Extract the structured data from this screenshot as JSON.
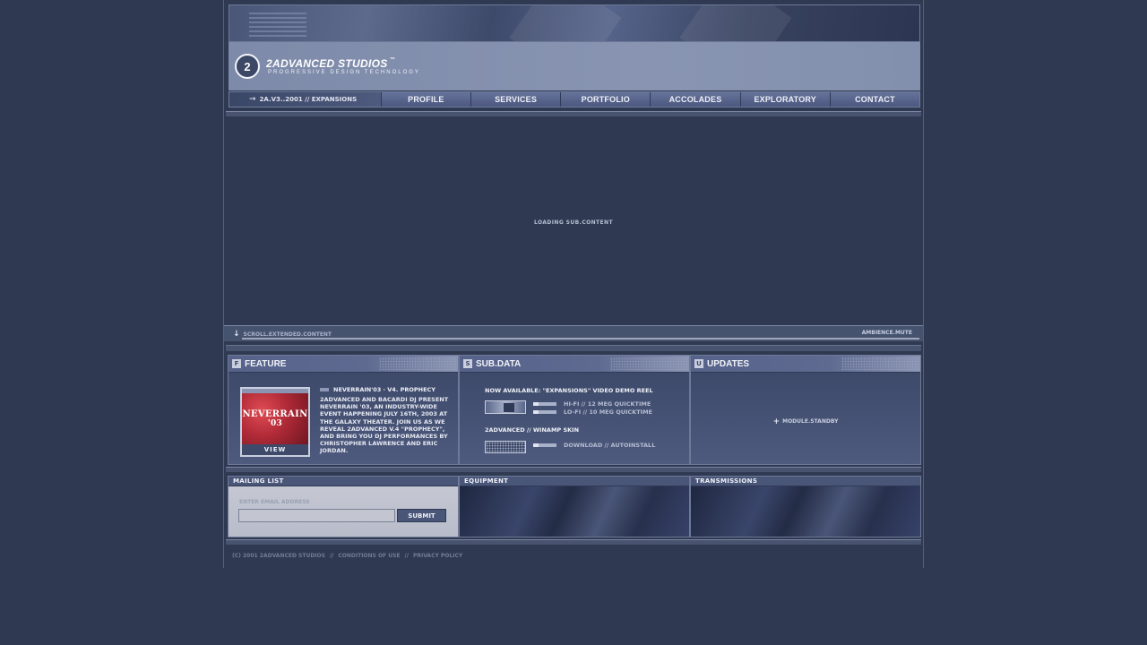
{
  "brand": {
    "name": "2ADVANCED STUDIOS",
    "trademark": "™",
    "tagline": "PROGRESSIVE DESIGN TECHNOLOGY",
    "mark": "2"
  },
  "nav": {
    "current": "2A.V3..2001 // EXPANSIONS",
    "items": [
      "PROFILE",
      "SERVICES",
      "PORTFOLIO",
      "ACCOLADES",
      "EXPLORATORY",
      "CONTACT"
    ]
  },
  "main": {
    "loading": "LOADING SUB.CONTENT"
  },
  "scroll_bar": {
    "scroll": "SCROLL.EXTENDED.CONTENT",
    "ambience": "AMBIENCE.MUTE"
  },
  "feature": {
    "title": "FEATURE",
    "headline": "NEVERRAIN'03 · V4. PROPHECY",
    "body": "2ADVANCED AND BACARDI DJ PRESENT NEVERRAIN '03, AN INDUSTRY-WIDE EVENT HAPPENING JULY 16TH, 2003 AT THE GALAXY THEATER. JOIN US AS WE REVEAL 2ADVANCED V.4 \"PROPHECY\", AND BRING YOU DJ PERFORMANCES BY CHRISTOPHER LAWRENCE AND ERIC JORDAN.",
    "thumb_line1": "NEVERRAIN",
    "thumb_line2": "'03",
    "view": "VIEW"
  },
  "subdata": {
    "title": "SUB.DATA",
    "now_available": "NOW AVAILABLE: \"EXPANSIONS\" VIDEO DEMO REEL",
    "hifi": "HI-FI // 12 MEG QUICKTIME",
    "lofi": "LO-FI // 10 MEG QUICKTIME",
    "winamp": "2ADVANCED // WINAMP SKIN",
    "download": "DOWNLOAD // AUTOINSTALL"
  },
  "updates": {
    "title": "UPDATES",
    "module": "MODULE.STANDBY"
  },
  "mailing": {
    "title": "MAILING LIST",
    "enter": "ENTER EMAIL ADDRESS",
    "input_value": "",
    "submit": "SUBMIT"
  },
  "equipment": {
    "title": "EQUIPMENT"
  },
  "transmissions": {
    "title": "TRANSMISSIONS"
  },
  "footer": {
    "copyright": "(C) 2001 2ADVANCED STUDIOS",
    "sep": "//",
    "conditions": "CONDITIONS OF USE",
    "privacy": "PRIVACY POLICY"
  }
}
